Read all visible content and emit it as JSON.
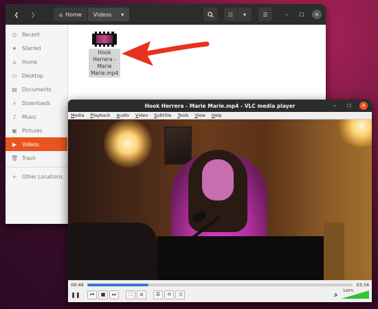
{
  "files": {
    "path": [
      "Home",
      "Videos"
    ],
    "sidebar": [
      {
        "label": "Recent",
        "icon": "clock-icon"
      },
      {
        "label": "Starred",
        "icon": "star-icon"
      },
      {
        "label": "Home",
        "icon": "home-icon"
      },
      {
        "label": "Desktop",
        "icon": "desktop-icon"
      },
      {
        "label": "Documents",
        "icon": "document-icon"
      },
      {
        "label": "Downloads",
        "icon": "download-icon"
      },
      {
        "label": "Music",
        "icon": "music-icon"
      },
      {
        "label": "Pictures",
        "icon": "picture-icon"
      },
      {
        "label": "Videos",
        "icon": "video-icon",
        "active": true
      },
      {
        "label": "Trash",
        "icon": "trash-icon"
      },
      {
        "label": "Other Locations",
        "icon": "plus-icon"
      }
    ],
    "file_item": {
      "name": "Hook Herrera - Marie Marie.mp4"
    },
    "accent": "#e9541f"
  },
  "vlc": {
    "title": "Hook Herrera - Marie Marie.mp4 - VLC media player",
    "menu": [
      "Media",
      "Playback",
      "Audio",
      "Video",
      "Subtitle",
      "Tools",
      "View",
      "Help"
    ],
    "elapsed": "00:49",
    "total": "03:34",
    "progress": 0.23,
    "volume_label": "100%",
    "accent": "#3b7bd6"
  }
}
